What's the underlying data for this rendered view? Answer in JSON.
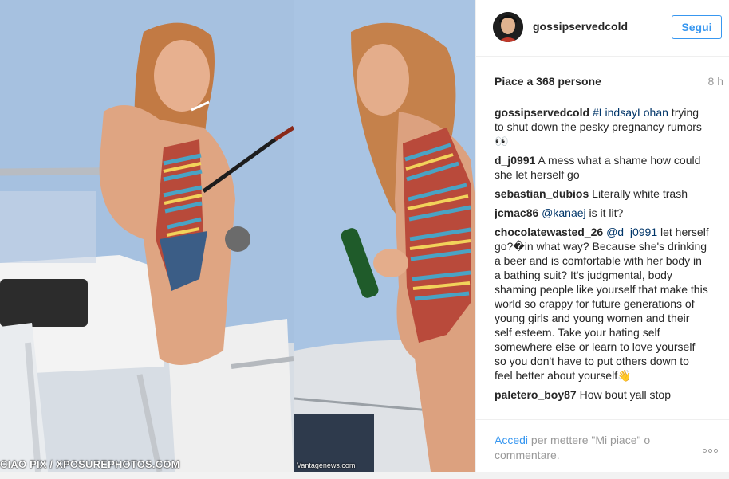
{
  "post": {
    "photo_credit_left": "CIAO PIX / XPOSUREPHOTOS.COM",
    "photo_credit_right": "Vantagenews.com"
  },
  "header": {
    "username": "gossipservedcold",
    "follow_label": "Segui"
  },
  "stats": {
    "likes": "Piace a 368 persone",
    "time": "8 h"
  },
  "comments": [
    {
      "user": "gossipservedcold",
      "mention": "#LindsayLohan",
      "text": " trying to shut down the pesky pregnancy rumors 👀"
    },
    {
      "user": "d_j0991",
      "mention": "",
      "text": " A mess what a shame how could she let herself go"
    },
    {
      "user": "sebastian_dubios",
      "mention": "",
      "text": " Literally white trash"
    },
    {
      "user": "jcmac86",
      "mention": "@kanaej",
      "text": " is it lit?"
    },
    {
      "user": "chocolatewasted_26",
      "mention": "@d_j0991",
      "text": " let herself go?�in what way? Because she's drinking a beer and is comfortable with her body in a bathing suit? It's judgmental, body shaming people like yourself that make this world so crappy for future generations of young girls and young women and their self esteem. Take your hating self somewhere else or learn to love yourself so you don't have to put others down to feel better about yourself👋"
    },
    {
      "user": "paletero_boy87",
      "mention": "",
      "text": " How bout yall stop"
    }
  ],
  "footer": {
    "login_link": "Accedi",
    "login_rest": " per mettere \"Mi piace\" o commentare.",
    "more_icon": "ellipsis-icon"
  },
  "colors": {
    "accent": "#3897f0",
    "hashtag": "#003569",
    "muted": "#999999",
    "text": "#262626"
  }
}
